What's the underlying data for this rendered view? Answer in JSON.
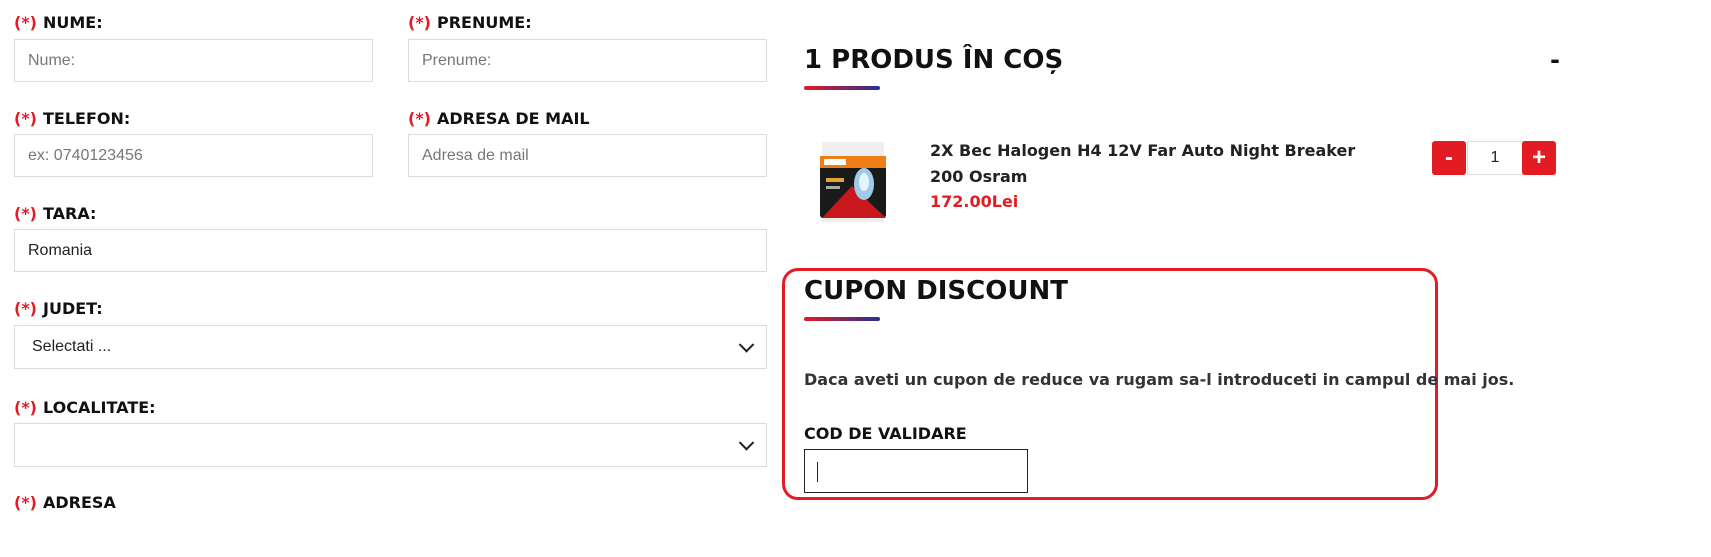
{
  "form": {
    "required_mark": "(*)",
    "nume": {
      "label": "NUME:",
      "placeholder": "Nume:"
    },
    "prenume": {
      "label": "PRENUME:",
      "placeholder": "Prenume:"
    },
    "telefon": {
      "label": "TELEFON:",
      "placeholder": "ex: 0740123456"
    },
    "mail": {
      "label": "ADRESA DE MAIL",
      "placeholder": "Adresa de mail"
    },
    "tara": {
      "label": "TARA:",
      "value": "Romania"
    },
    "judet": {
      "label": "JUDET:",
      "value": "Selectati ..."
    },
    "localitate": {
      "label": "LOCALITATE:",
      "value": ""
    },
    "adresa": {
      "label": "ADRESA"
    }
  },
  "cart": {
    "title": "1 PRODUS ÎN COȘ",
    "collapse_label": "-",
    "item": {
      "name": "2X Bec Halogen H4 12V Far Auto Night Breaker 200 Osram",
      "price": "172.00Lei",
      "quantity": "1",
      "minus_label": "-",
      "plus_label": "+"
    }
  },
  "coupon": {
    "title": "CUPON DISCOUNT",
    "description": "Daca aveti un cupon de reduce va rugam sa-l introduceti in campul de mai jos.",
    "code_label": "COD DE VALIDARE",
    "code_value": ""
  },
  "colors": {
    "accent_red": "#e31b23",
    "accent_blue": "#2b2f8f",
    "highlight_border": "#e31b23"
  },
  "icons": {
    "select_arrow": "chevron-down-icon",
    "product_thumb": "product-image"
  }
}
